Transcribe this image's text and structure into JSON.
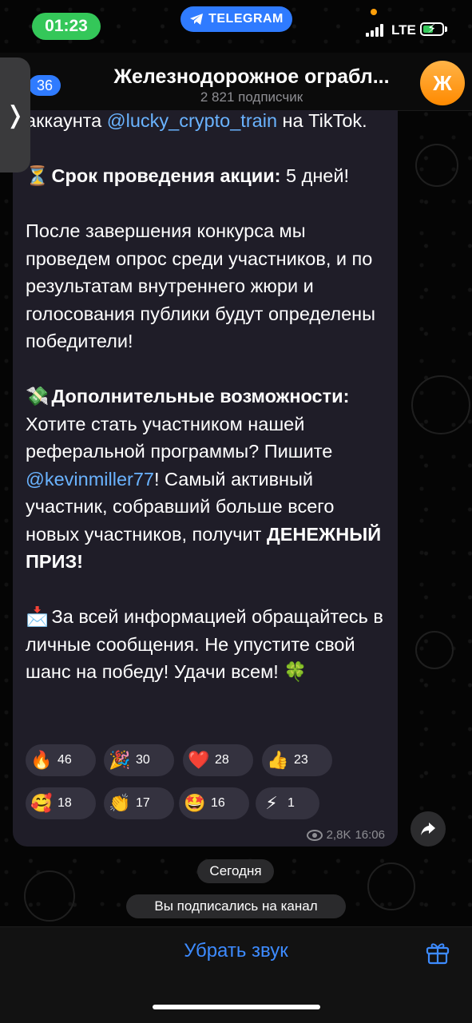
{
  "status_bar": {
    "time": "01:23",
    "app_pill": "TELEGRAM",
    "network": "LTE"
  },
  "header": {
    "unread_badge": "36",
    "title": "Железнодорожное ограбл...",
    "subtitle": "2 821 подписчик",
    "avatar_letter": "Ж"
  },
  "side_tab": {
    "chevron": "❭"
  },
  "message": {
    "p1_prefix": "аккаунта ",
    "p1_link": "@lucky_crypto_train",
    "p1_suffix": " на TikTok.",
    "p2_emoji": "⏳",
    "p2_bold": "Срок проведения акции:",
    "p2_rest": " 5 дней!",
    "p3": "После завершения конкурса мы проведем опрос среди участников, и по результатам внутреннего жюри и голосования публики будут определены победители!",
    "p4_emoji": "💸",
    "p4_bold": "Дополнительные возможности:",
    "p4_rest1": " Хотите стать участником нашей реферальной программы? Пишите ",
    "p4_link": "@kevinmiller77",
    "p4_rest2": "! Самый активный участник, собравший больше всего новых участников, получит ",
    "p4_bold2": "ДЕНЕЖНЫЙ ПРИЗ!",
    "p5_emoji": "📩",
    "p5_text": " За всей информацией обращайтесь в личные сообщения. Не упустите свой шанс на победу! Удачи всем! 🍀",
    "views": "2,8K",
    "time": "16:06"
  },
  "reactions": [
    {
      "emoji": "🔥",
      "count": "46"
    },
    {
      "emoji": "🎉",
      "count": "30"
    },
    {
      "emoji": "❤️",
      "count": "28"
    },
    {
      "emoji": "👍",
      "count": "23"
    },
    {
      "emoji": "🥰",
      "count": "18"
    },
    {
      "emoji": "👏",
      "count": "17"
    },
    {
      "emoji": "🤩",
      "count": "16"
    },
    {
      "emoji": "⚡",
      "count": "1"
    }
  ],
  "service": {
    "date": "Сегодня",
    "subscribed": "Вы подписались на канал"
  },
  "bottom_bar": {
    "mute_label": "Убрать звук",
    "gift_icon": "gift-icon"
  },
  "colors": {
    "accent": "#3d8bff",
    "bubble": "#1f1d28",
    "link": "#6ab3ff",
    "time_pill": "#34c759"
  }
}
